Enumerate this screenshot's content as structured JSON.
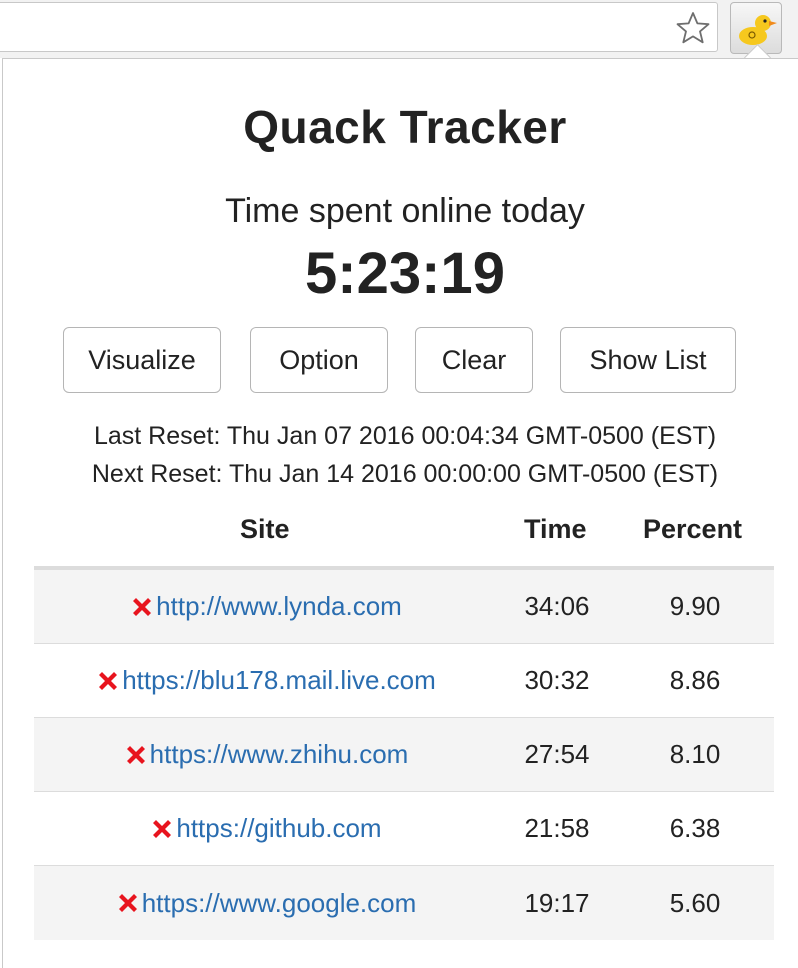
{
  "browser": {
    "star_icon": "star-outline-icon",
    "extension_icon": "duck-icon"
  },
  "popup": {
    "title": "Quack Tracker",
    "subtitle": "Time spent online today",
    "timer": "5:23:19",
    "buttons": {
      "visualize": "Visualize",
      "option": "Option",
      "clear": "Clear",
      "show_list": "Show List"
    },
    "last_reset": "Last Reset: Thu Jan 07 2016 00:04:34 GMT-0500 (EST)",
    "next_reset": "Next Reset: Thu Jan 14 2016 00:00:00 GMT-0500 (EST)",
    "table": {
      "headers": {
        "site": "Site",
        "time": "Time",
        "percent": "Percent"
      },
      "rows": [
        {
          "site": "http://www.lynda.com",
          "time": "34:06",
          "percent": "9.90"
        },
        {
          "site": "https://blu178.mail.live.com",
          "time": "30:32",
          "percent": "8.86"
        },
        {
          "site": "https://www.zhihu.com",
          "time": "27:54",
          "percent": "8.10"
        },
        {
          "site": "https://github.com",
          "time": "21:58",
          "percent": "6.38"
        },
        {
          "site": "https://www.google.com",
          "time": "19:17",
          "percent": "5.60"
        }
      ]
    }
  },
  "colors": {
    "link": "#2a6db0",
    "delete_icon": "#e8141e",
    "row_alt": "#f4f4f4",
    "duck": "#f6c81e"
  }
}
